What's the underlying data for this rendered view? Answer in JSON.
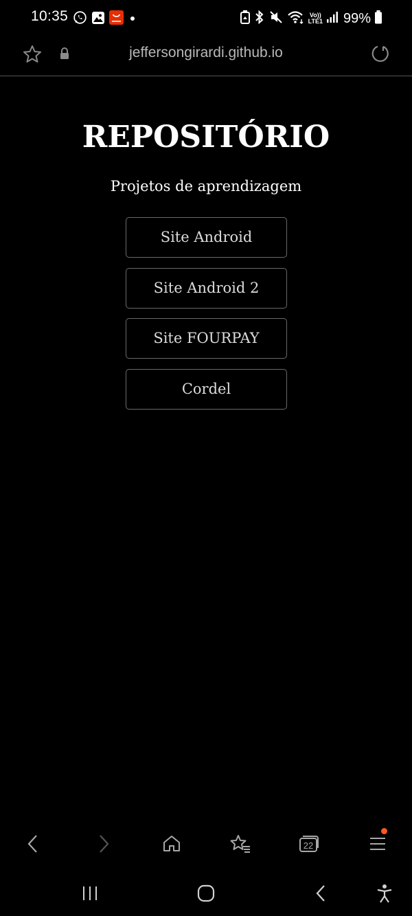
{
  "status_bar": {
    "time": "10:35",
    "battery": "99%",
    "left_icons": [
      "whatsapp-icon",
      "gallery-icon",
      "aliexpress-icon",
      "notification-dot-icon"
    ],
    "right_icons": [
      "battery-saver-icon",
      "bluetooth-icon",
      "mute-icon",
      "wifi-icon",
      "volte-icon",
      "signal-icon",
      "battery-icon"
    ],
    "volte_label_top": "Vo))",
    "volte_label_bottom": "LTE1"
  },
  "url_bar": {
    "url": "jeffersongirardi.github.io"
  },
  "page": {
    "title": "REPOSITÓRIO",
    "subtitle": "Projetos de aprendizagem",
    "projects": [
      {
        "label": "Site Android"
      },
      {
        "label": "Site Android 2"
      },
      {
        "label": "Site FOURPAY"
      },
      {
        "label": "Cordel"
      }
    ]
  },
  "browser_toolbar": {
    "tab_count": "22",
    "icons": [
      "back-icon",
      "forward-icon",
      "home-icon",
      "bookmarks-icon",
      "tabs-icon",
      "menu-icon"
    ]
  },
  "system_nav": {
    "icons": [
      "recent-apps-icon",
      "home-nav-icon",
      "back-nav-icon",
      "accessibility-icon"
    ]
  },
  "colors": {
    "background": "#000000",
    "text": "#ffffff",
    "button_text": "#dcdcdc",
    "button_border": "#6a6a6a",
    "url_text": "#b8b8b8",
    "notification_dot": "#ff5a1f",
    "aliexpress_red": "#e62e04"
  }
}
